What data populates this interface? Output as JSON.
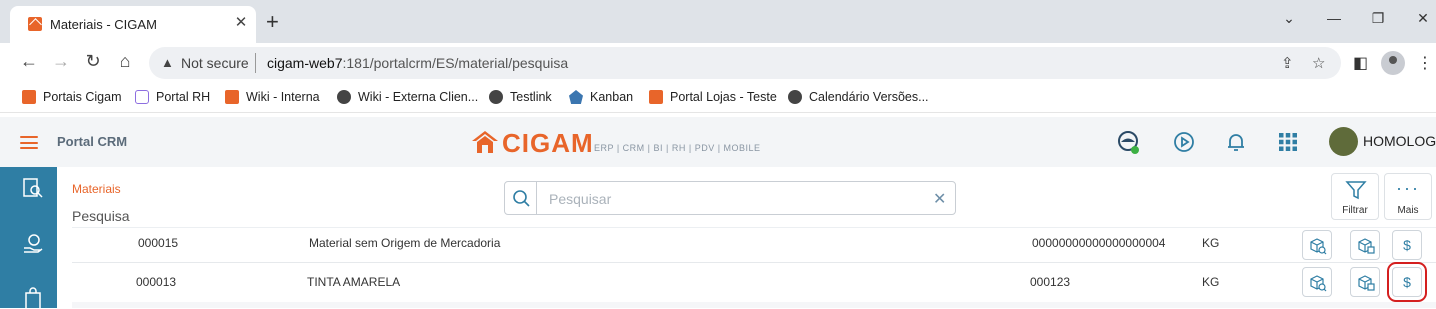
{
  "browser": {
    "tab_title": "Materiais - CIGAM",
    "address": {
      "security_label": "Not secure",
      "url_host": "cigam-web7",
      "url_rest": ":181/portalcrm/ES/material/pesquisa"
    },
    "bookmarks": [
      {
        "label": "Portais Cigam",
        "icon": "cigam-icon"
      },
      {
        "label": "Portal RH",
        "icon": "chat-icon"
      },
      {
        "label": "Wiki - Interna",
        "icon": "cigam-icon"
      },
      {
        "label": "Wiki - Externa Clien...",
        "icon": "globe-icon"
      },
      {
        "label": "Testlink",
        "icon": "globe-icon"
      },
      {
        "label": "Kanban",
        "icon": "kanban-icon"
      },
      {
        "label": "Portal Lojas - Teste",
        "icon": "cigam-icon"
      },
      {
        "label": "Calendário Versões...",
        "icon": "globe-icon"
      }
    ]
  },
  "app": {
    "portal_title": "Portal CRM",
    "logo_word": "CIGAM",
    "logo_sub": "ERP | CRM | BI | RH | PDV | MOBILE",
    "user_name": "HOMOLOG",
    "accent": "#e8652a",
    "sidebar_color": "#2f7ea4"
  },
  "page": {
    "breadcrumb": "Materiais",
    "subtitle": "Pesquisa",
    "search_placeholder": "Pesquisar",
    "filter_label": "Filtrar",
    "more_label": "Mais"
  },
  "table": {
    "rows": [
      {
        "code": "000015",
        "description": "Material sem Origem de Mercadoria",
        "ref": "00000000000000000004",
        "unit": "KG"
      },
      {
        "code": "000013",
        "description": "TINTA AMARELA",
        "ref": "000123",
        "unit": "KG"
      }
    ],
    "action_price_symbol": "$"
  }
}
